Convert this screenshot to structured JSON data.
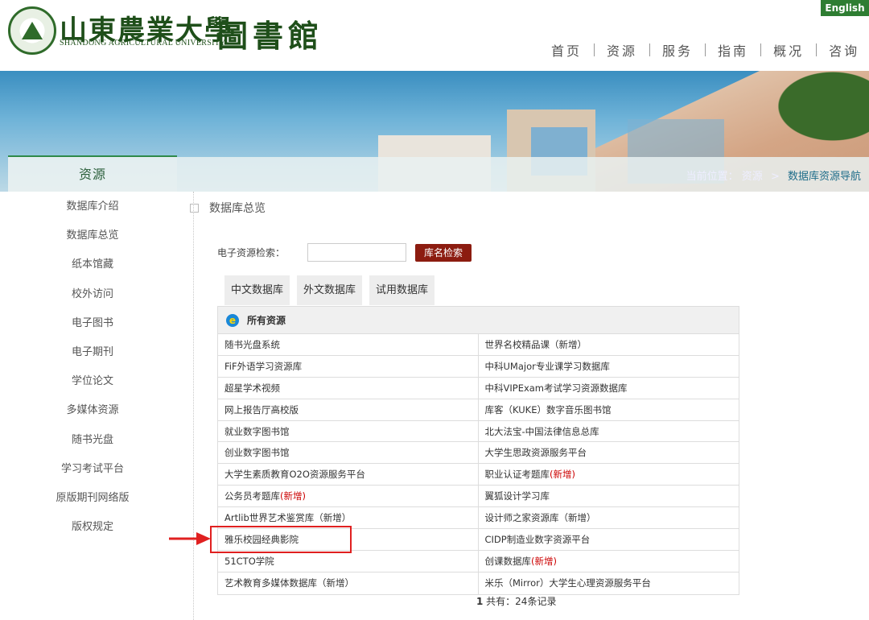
{
  "header": {
    "logo_cn": "山東農業大學",
    "logo_en": "SHANDONG AGRICULTURAL UNIVERSITY",
    "library": "圖書館",
    "english_label": "English",
    "nav": [
      "首页",
      "资源",
      "服务",
      "指南",
      "概况",
      "咨询"
    ]
  },
  "banner": {
    "section_title": "资源",
    "breadcrumb_prefix": "当前位置：",
    "breadcrumb_parent": "资源",
    "breadcrumb_sep": ">",
    "breadcrumb_current": "数据库资源导航"
  },
  "sidebar": {
    "items": [
      "数据库介绍",
      "数据库总览",
      "纸本馆藏",
      "校外访问",
      "电子图书",
      "电子期刊",
      "学位论文",
      "多媒体资源",
      "随书光盘",
      "学习考试平台",
      "原版期刊网络版",
      "版权规定"
    ]
  },
  "main": {
    "title": "数据库总览",
    "search_label": "电子资源检索：",
    "search_value": "",
    "search_button": "库名检索",
    "tabs": [
      "中文数据库",
      "外文数据库",
      "试用数据库"
    ],
    "table_header": "所有资源",
    "rows": [
      [
        {
          "t": "随书光盘系统",
          "n": ""
        },
        {
          "t": "世界名校精品课（新增）",
          "n": ""
        }
      ],
      [
        {
          "t": "FiF外语学习资源库",
          "n": ""
        },
        {
          "t": "中科UMajor专业课学习数据库",
          "n": ""
        }
      ],
      [
        {
          "t": "超星学术视频",
          "n": ""
        },
        {
          "t": "中科VIPExam考试学习资源数据库",
          "n": ""
        }
      ],
      [
        {
          "t": "网上报告厅高校版",
          "n": ""
        },
        {
          "t": "库客（KUKE）数字音乐图书馆",
          "n": ""
        }
      ],
      [
        {
          "t": "就业数字图书馆",
          "n": ""
        },
        {
          "t": "北大法宝-中国法律信息总库",
          "n": ""
        }
      ],
      [
        {
          "t": "创业数字图书馆",
          "n": ""
        },
        {
          "t": "大学生思政资源服务平台",
          "n": ""
        }
      ],
      [
        {
          "t": "大学生素质教育O2O资源服务平台",
          "n": ""
        },
        {
          "t": "职业认证考题库",
          "n": "(新增)"
        }
      ],
      [
        {
          "t": "公务员考题库",
          "n": "(新增)"
        },
        {
          "t": "翼狐设计学习库",
          "n": ""
        }
      ],
      [
        {
          "t": "Artlib世界艺术鉴赏库（新增）",
          "n": ""
        },
        {
          "t": "设计师之家资源库（新增）",
          "n": ""
        }
      ],
      [
        {
          "t": "雅乐校园经典影院",
          "n": ""
        },
        {
          "t": "CIDP制造业数字资源平台",
          "n": ""
        }
      ],
      [
        {
          "t": "51CTO学院",
          "n": ""
        },
        {
          "t": "创课数据库",
          "n": "(新增)"
        }
      ],
      [
        {
          "t": "艺术教育多媒体数据库（新增）",
          "n": ""
        },
        {
          "t": "米乐（Mirror）大学生心理资源服务平台",
          "n": ""
        }
      ]
    ],
    "pager_page": "1",
    "pager_text": " 共有：24条记录"
  },
  "colors": {
    "brand_green": "#2e7d32",
    "search_btn": "#8c1c10",
    "highlight": "#e02020"
  }
}
